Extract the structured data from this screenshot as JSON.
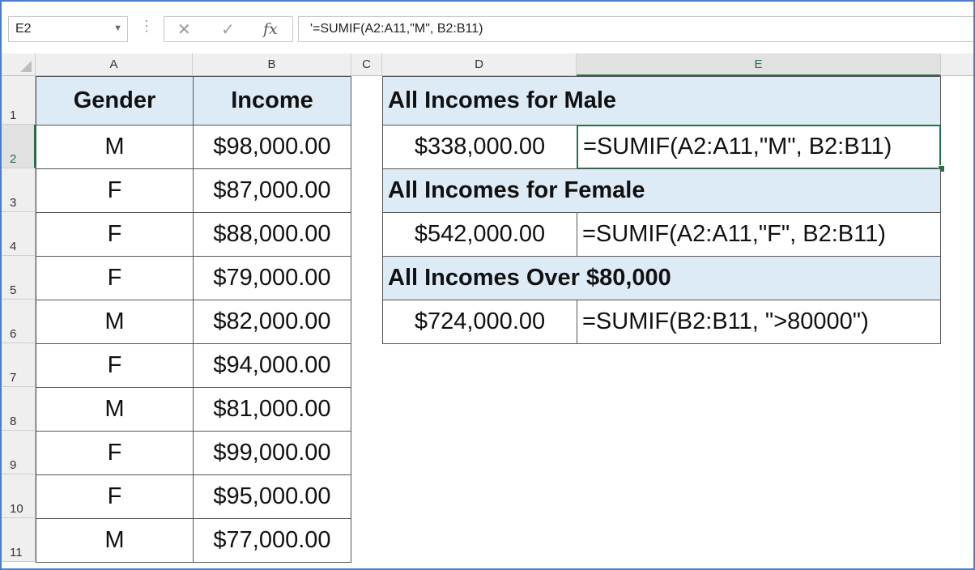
{
  "name_box": "E2",
  "formula_bar": "'=SUMIF(A2:A11,\"M\", B2:B11)",
  "columns": [
    "A",
    "B",
    "C",
    "D",
    "E"
  ],
  "rows": [
    "1",
    "2",
    "3",
    "4",
    "5",
    "6",
    "7",
    "8",
    "9",
    "10",
    "11"
  ],
  "left_table": {
    "headers": [
      "Gender",
      "Income"
    ],
    "rows": [
      [
        "M",
        "$98,000.00"
      ],
      [
        "F",
        "$87,000.00"
      ],
      [
        "F",
        "$88,000.00"
      ],
      [
        "F",
        "$79,000.00"
      ],
      [
        "M",
        "$82,000.00"
      ],
      [
        "F",
        "$94,000.00"
      ],
      [
        "M",
        "$81,000.00"
      ],
      [
        "F",
        "$99,000.00"
      ],
      [
        "F",
        "$95,000.00"
      ],
      [
        "M",
        "$77,000.00"
      ]
    ]
  },
  "right_table": [
    {
      "title": "All Incomes for Male",
      "value": "$338,000.00",
      "formula": "=SUMIF(A2:A11,\"M\", B2:B11)"
    },
    {
      "title": "All Incomes for Female",
      "value": "$542,000.00",
      "formula": "=SUMIF(A2:A11,\"F\", B2:B11)"
    },
    {
      "title": "All Incomes Over $80,000",
      "value": "$724,000.00",
      "formula": "=SUMIF(B2:B11, \">80000\")"
    }
  ],
  "colors": {
    "accent": "#217346",
    "header_fill": "#ddebf7",
    "frame": "#4a7fc8"
  },
  "icons": [
    "cancel-icon",
    "enter-icon",
    "function-icon",
    "dropdown-icon"
  ]
}
